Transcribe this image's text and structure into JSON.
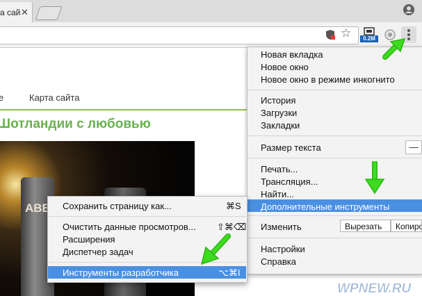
{
  "tab": {
    "title": "а сай",
    "close_glyph": "✕"
  },
  "toolbar": {
    "extension_badge": "0.2M",
    "star_glyph": "☆"
  },
  "page": {
    "nav_partial": "е",
    "nav_sitemap": "Карта сайта",
    "heading": "Шотландии с любовью",
    "bottle_text": "ABE"
  },
  "main_menu": {
    "items": [
      "Новая вкладка",
      "Новое окно",
      "Новое окно в режиме инкогнито",
      "История",
      "Загрузки",
      "Закладки",
      "Размер текста",
      "Печать...",
      "Трансляция...",
      "Найти...",
      "Дополнительные инструменты",
      "Изменить",
      "Настройки",
      "Справка"
    ],
    "zoom_minus": "—",
    "edit_buttons": [
      "Вырезать",
      "Копиров"
    ]
  },
  "submenu": {
    "items": [
      {
        "label": "Сохранить страницу как...",
        "shortcut": "⌘S"
      },
      {
        "label": "Очистить данные просмотров...",
        "shortcut": "⇧⌘⌫"
      },
      {
        "label": "Расширения",
        "shortcut": ""
      },
      {
        "label": "Диспетчер задач",
        "shortcut": ""
      },
      {
        "label": "Инструменты разработчика",
        "shortcut": "⌥⌘I"
      }
    ]
  },
  "watermark": {
    "text": "WPNEW.RU"
  },
  "colors": {
    "highlight": "#4a90e2",
    "arrow_green": "#3ddc1e",
    "heading_green": "#6ab04c"
  }
}
